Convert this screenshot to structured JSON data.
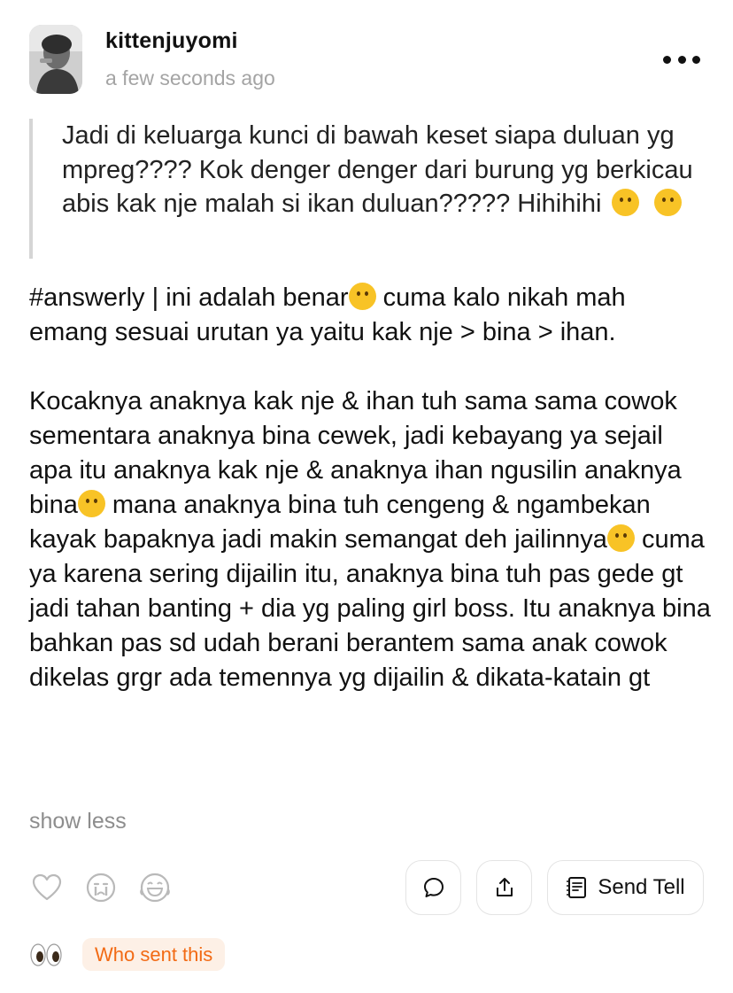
{
  "header": {
    "username": "kittenjuyomi",
    "timestamp": "a few seconds ago",
    "more_icon": "more-horizontal-icon"
  },
  "question": {
    "text": "Jadi di keluarga kunci di bawah keset siapa duluan yg mpreg???? Kok denger denger dari burung yg berkicau abis kak nje malah si ikan duluan?????",
    "tail": "Hihihihi",
    "emojis": [
      "face-with-open-eyes-and-hand-over-mouth-icon",
      "face-with-hand-over-mouth-icon"
    ]
  },
  "answer": {
    "p1_a": "#answerly | ini adalah benar",
    "p1_b": " cuma kalo nikah mah emang sesuai urutan ya yaitu kak nje > bina > ihan.",
    "p2_a": "Kocaknya anaknya kak nje & ihan tuh sama sama cowok sementara anaknya bina cewek, jadi kebayang ya sejail apa itu anaknya kak nje & anaknya ihan ngusilin anaknya bina",
    "p2_b": " mana anaknya bina tuh cengeng & ngambekan kayak bapaknya jadi makin semangat deh jailinnya",
    "p2_c": "cuma ya karena sering dijailin itu, anaknya bina tuh pas gede gt jadi tahan banting + dia yg paling girl boss. Itu anaknya bina bahkan pas sd udah berani berantem sama anak cowok dikelas grgr ada temennya yg dijailin & dikata-katain gt",
    "emojis": [
      "kissing-face-icon",
      "grinning-face-icon",
      "slightly-smiling-face-icon"
    ]
  },
  "show_less": "show less",
  "actions": {
    "reactions": [
      "heart-icon",
      "crying-face-icon",
      "laughing-face-icon"
    ],
    "comment_icon": "comment-bubble-icon",
    "share_icon": "share-icon",
    "send_tell_label": "Send Tell",
    "send_tell_icon": "note-icon"
  },
  "footer": {
    "eyes_icon": "eyes-icon",
    "who_sent_label": "Who sent this"
  },
  "colors": {
    "accent": "#f26a14",
    "accent_bg": "#fdf0e6",
    "muted_text": "#a4a4a4",
    "border": "#e4e4e4"
  }
}
